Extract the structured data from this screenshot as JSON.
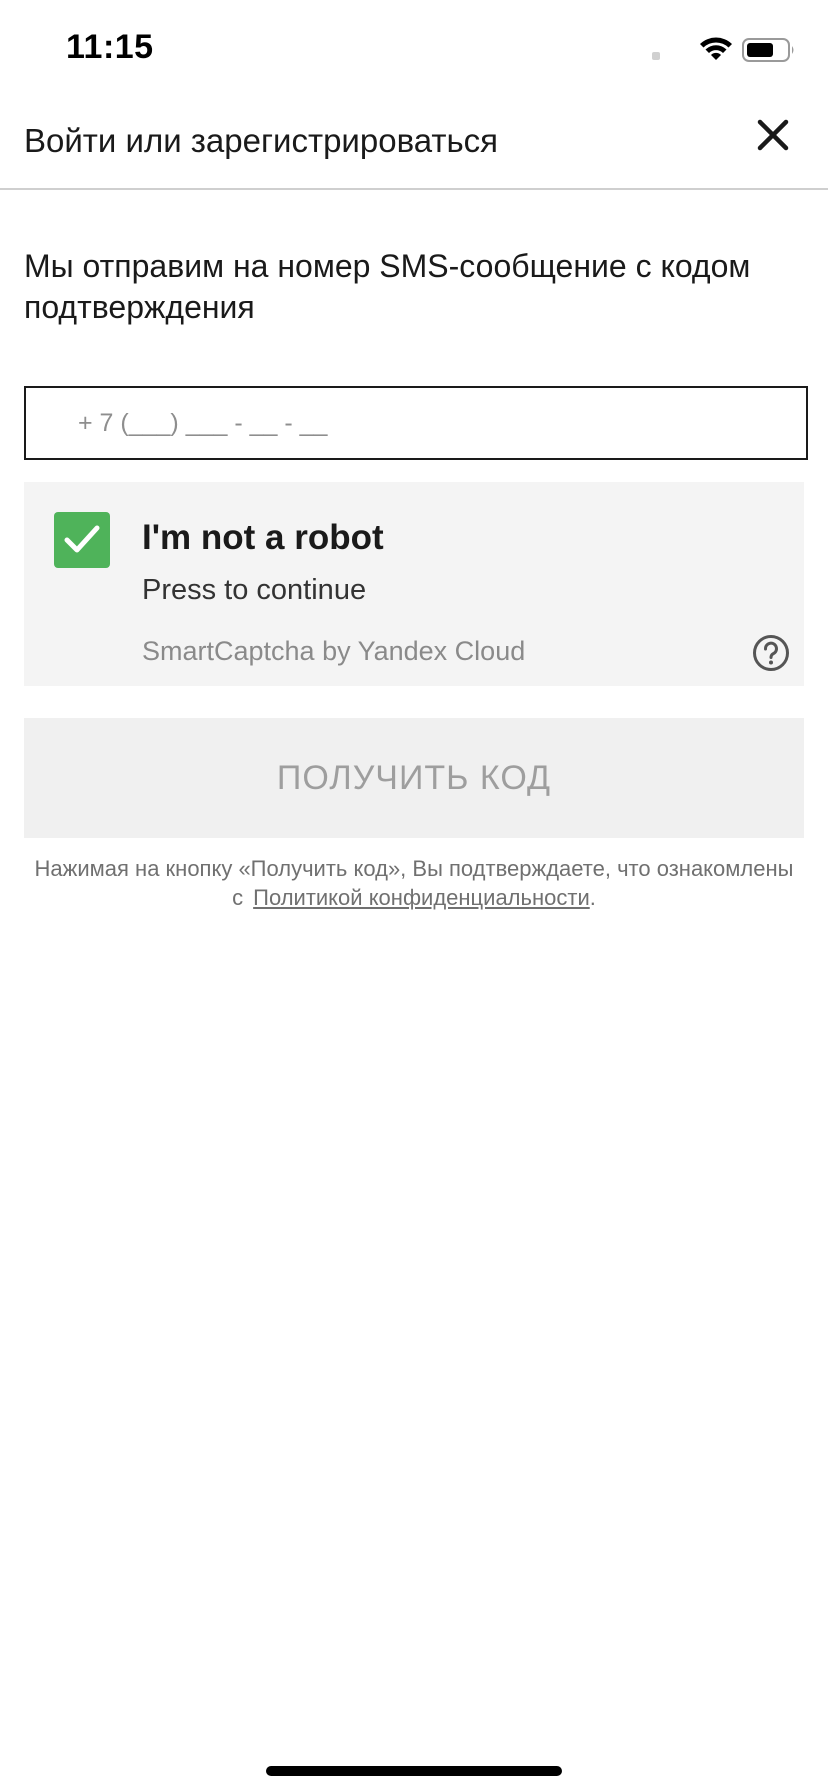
{
  "status_bar": {
    "time": "11:15",
    "icons": [
      "wifi-icon",
      "battery-icon"
    ]
  },
  "header": {
    "title": "Войти или зарегистрироваться",
    "close_icon": "close-icon"
  },
  "intro_text": "Мы отправим на номер SMS-сообщение с кодом подтверждения",
  "phone_field": {
    "placeholder": "+ 7 (___) ___ - __ - __",
    "value": ""
  },
  "captcha": {
    "checked": true,
    "title": "I'm not a robot",
    "subtitle": "Press to continue",
    "brand": "SmartCaptcha by Yandex Cloud",
    "check_color": "#4fb35a",
    "help_icon": "question-circle-icon"
  },
  "submit_button": {
    "label": "ПОЛУЧИТЬ КОД",
    "disabled": true
  },
  "consent": {
    "text": "Нажимая на кнопку «Получить код», Вы подтверждаете, что ознакомлены с",
    "link": "Политикой конфиденциальности",
    "end": "."
  }
}
